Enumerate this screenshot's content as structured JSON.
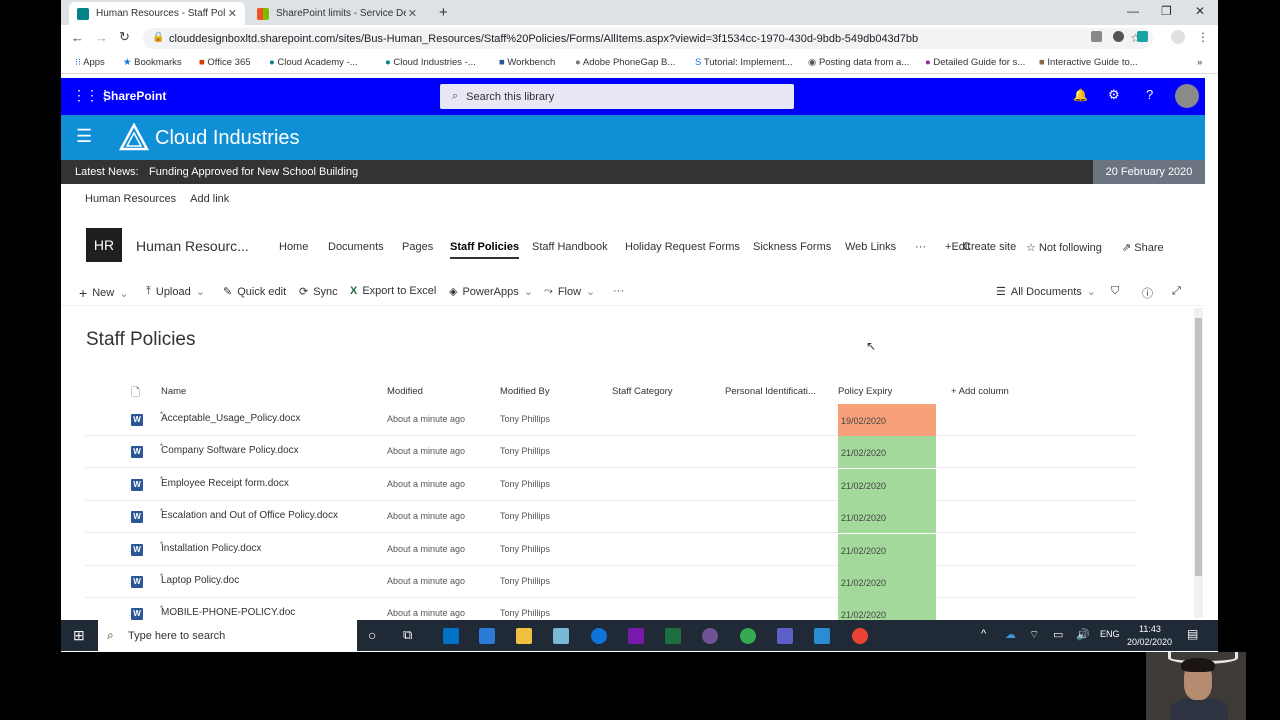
{
  "browser": {
    "tabs": [
      {
        "title": "Human Resources - Staff Policies",
        "fav_color": "#038387"
      },
      {
        "title": "SharePoint limits - Service Descri",
        "fav_color": "#f25022"
      }
    ],
    "url": "clouddesignboxltd.sharepoint.com/sites/Bus-Human_Resources/Staff%20Policies/Forms/AllItems.aspx?viewid=3f1534cc-1970-430d-9bdb-549db043d7bb",
    "bookmarks": [
      "Apps",
      "Bookmarks",
      "Office 365",
      "Cloud Academy -...",
      "Cloud Industries -...",
      "Workbench",
      "Adobe PhoneGap B...",
      "Tutorial: Implement...",
      "Posting data from a...",
      "Detailed Guide for s...",
      "Interactive Guide to..."
    ],
    "more": "»"
  },
  "suite": {
    "app_name": "SharePoint",
    "search_placeholder": "Search this library",
    "brand_color": "#0000ff"
  },
  "site": {
    "name": "Cloud Industries",
    "news_label": "Latest News:",
    "news_text": "Funding Approved for New School Building",
    "news_date": "20 February 2020",
    "hub_nav": [
      "Human Resources",
      "Add link"
    ],
    "logo_initials": "HR",
    "title": "Human Resourc...",
    "nav": [
      "Home",
      "Documents",
      "Pages",
      "Staff Policies",
      "Staff Handbook",
      "Holiday Request Forms",
      "Sickness Forms",
      "Web Links",
      "···"
    ],
    "actions": {
      "edit": "Edit",
      "create": "Create site",
      "follow": "Not following",
      "share": "Share"
    }
  },
  "commands": {
    "new": "New",
    "upload": "Upload",
    "quick_edit": "Quick edit",
    "sync": "Sync",
    "export": "Export to Excel",
    "powerapps": "PowerApps",
    "flow": "Flow",
    "more": "···",
    "view": "All Documents"
  },
  "library": {
    "title": "Staff Policies",
    "columns": [
      "Name",
      "Modified",
      "Modified By",
      "Staff Category",
      "Personal Identificati...",
      "Policy Expiry",
      "Add column"
    ],
    "rows": [
      {
        "name": "Acceptable_Usage_Policy.docx",
        "modified": "About a minute ago",
        "by": "Tony Phillips",
        "expiry": "19/02/2020",
        "status_color": "#f7a07a"
      },
      {
        "name": "Company Software Policy.docx",
        "modified": "About a minute ago",
        "by": "Tony Phillips",
        "expiry": "21/02/2020",
        "status_color": "#a3d99b"
      },
      {
        "name": "Employee Receipt form.docx",
        "modified": "About a minute ago",
        "by": "Tony Phillips",
        "expiry": "21/02/2020",
        "status_color": "#a3d99b"
      },
      {
        "name": "Escalation and Out of Office Policy.docx",
        "modified": "About a minute ago",
        "by": "Tony Phillips",
        "expiry": "21/02/2020",
        "status_color": "#a3d99b"
      },
      {
        "name": "Installation Policy.docx",
        "modified": "About a minute ago",
        "by": "Tony Phillips",
        "expiry": "21/02/2020",
        "status_color": "#a3d99b"
      },
      {
        "name": "Laptop Policy.doc",
        "modified": "About a minute ago",
        "by": "Tony Phillips",
        "expiry": "21/02/2020",
        "status_color": "#a3d99b"
      },
      {
        "name": "MOBILE-PHONE-POLICY.doc",
        "modified": "About a minute ago",
        "by": "Tony Phillips",
        "expiry": "21/02/2020",
        "status_color": "#a3d99b"
      }
    ]
  },
  "taskbar": {
    "search_placeholder": "Type here to search",
    "lang": "ENG",
    "time": "11:43",
    "date": "20/02/2020"
  }
}
